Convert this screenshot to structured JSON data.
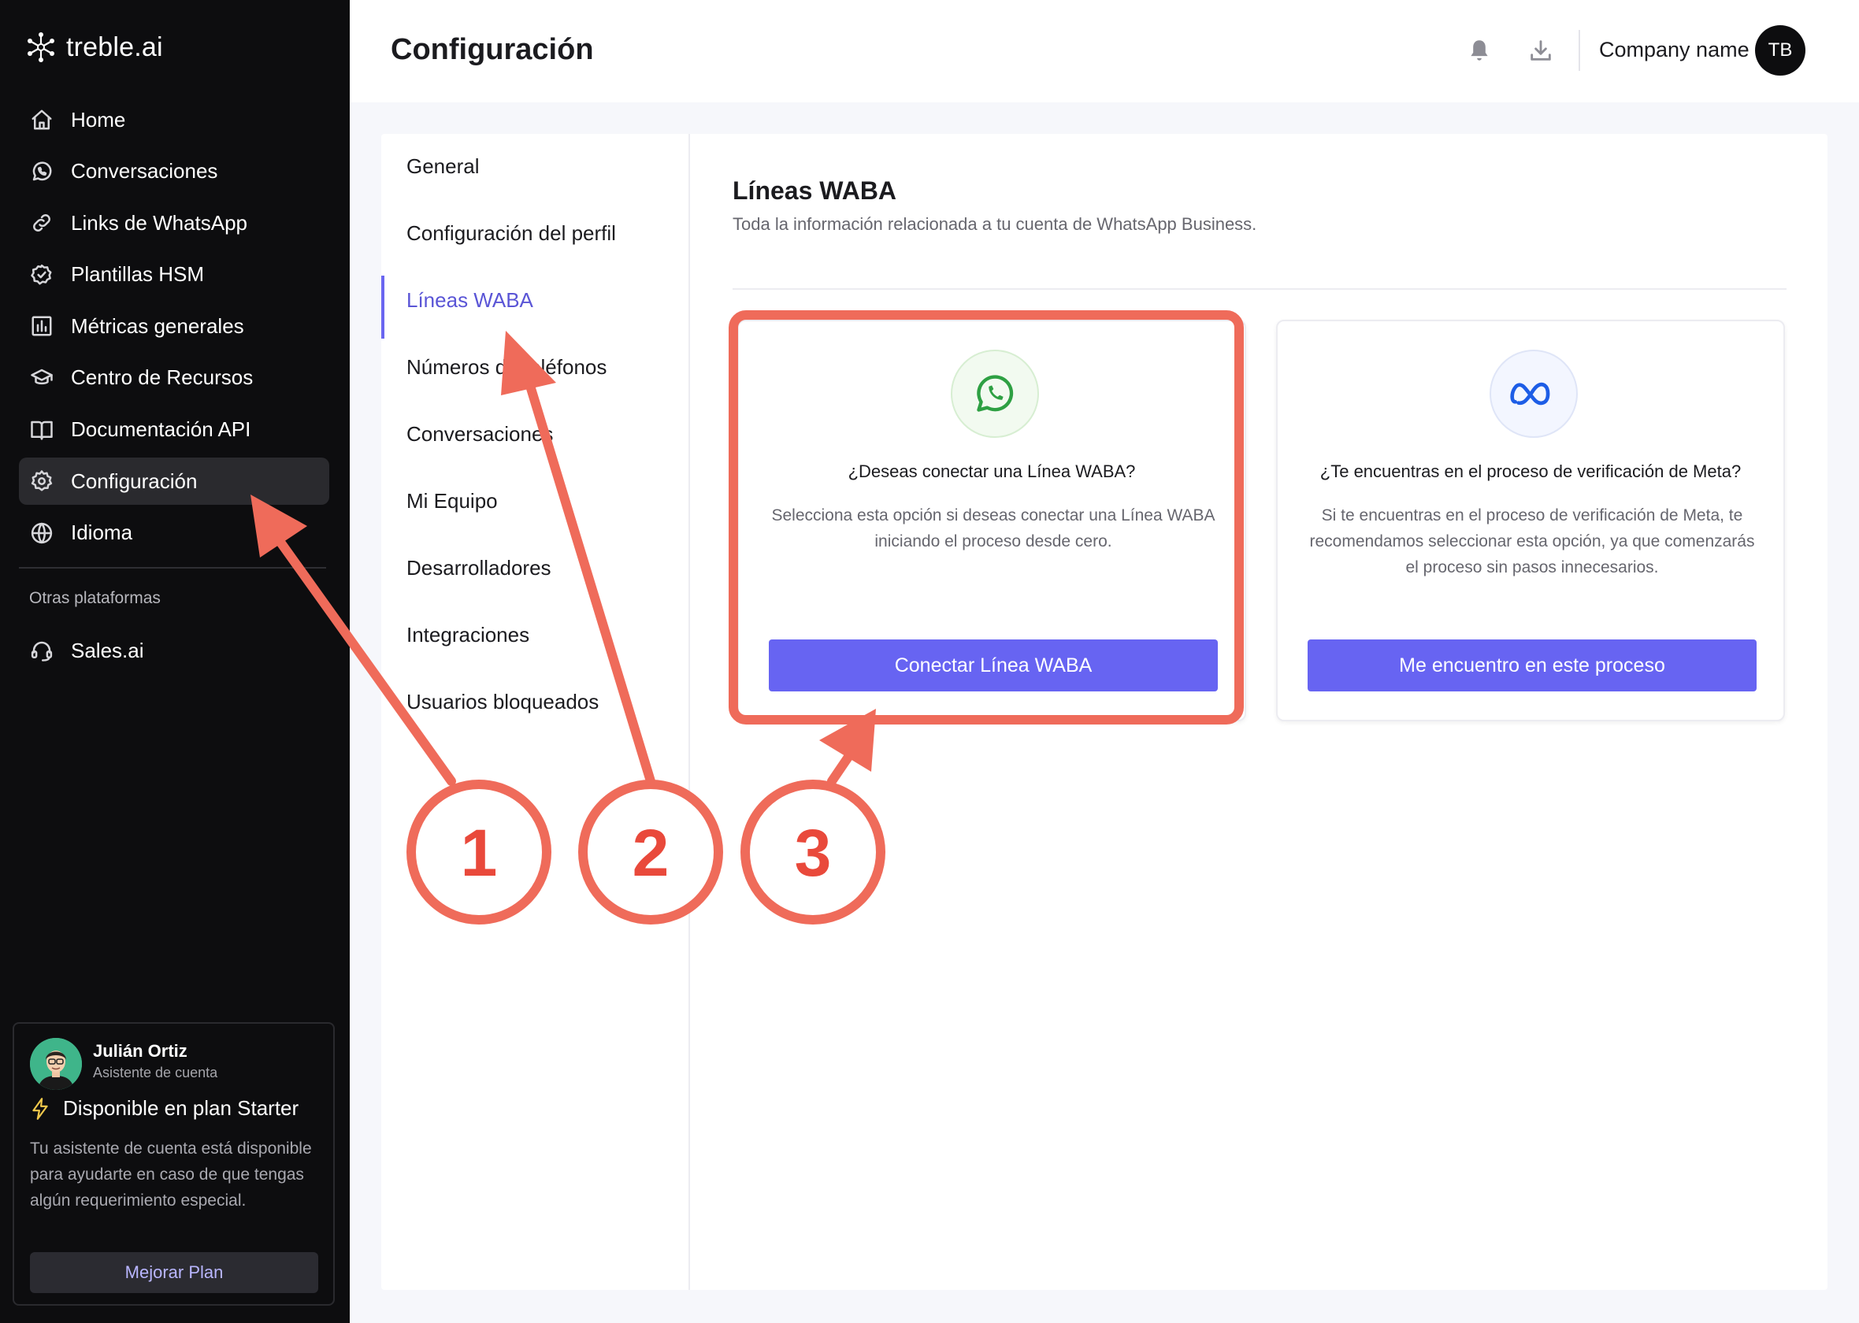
{
  "app": {
    "logo_text": "treble.ai"
  },
  "sidebar": {
    "items": [
      {
        "label": "Home",
        "icon": "home-icon"
      },
      {
        "label": "Conversaciones",
        "icon": "whatsapp-icon"
      },
      {
        "label": "Links de WhatsApp",
        "icon": "link-icon"
      },
      {
        "label": "Plantillas HSM",
        "icon": "badge-check-icon"
      },
      {
        "label": "Métricas generales",
        "icon": "bar-chart-icon"
      },
      {
        "label": "Centro de Recursos",
        "icon": "graduation-cap-icon"
      },
      {
        "label": "Documentación API",
        "icon": "book-icon"
      },
      {
        "label": "Configuración",
        "icon": "gear-icon",
        "active": true
      },
      {
        "label": "Idioma",
        "icon": "globe-icon"
      }
    ],
    "other_section_label": "Otras plataformas",
    "other_items": [
      {
        "label": "Sales.ai",
        "icon": "headset-icon"
      }
    ],
    "assistant": {
      "name": "Julián Ortiz",
      "role": "Asistente de cuenta",
      "plan_text": "Disponible en plan Starter",
      "description": "Tu asistente de cuenta está disponible para ayudarte en caso de que tengas algún requerimiento especial.",
      "upgrade_label": "Mejorar Plan"
    }
  },
  "header": {
    "title": "Configuración",
    "company_name": "Company name",
    "avatar_initials": "TB"
  },
  "settings_nav": {
    "items": [
      "General",
      "Configuración del perfil",
      "Líneas WABA",
      "Números de teléfonos",
      "Conversaciones",
      "Mi Equipo",
      "Desarrolladores",
      "Integraciones",
      "Usuarios bloqueados"
    ],
    "active_index": 2
  },
  "content": {
    "title": "Líneas WABA",
    "subtitle": "Toda la información relacionada a tu cuenta de WhatsApp Business.",
    "cards": [
      {
        "icon": "whatsapp-icon",
        "question": "¿Deseas conectar una Línea WABA?",
        "description": "Selecciona esta opción si deseas conectar una Línea WABA iniciando el proceso desde cero.",
        "button_label": "Conectar Línea WABA"
      },
      {
        "icon": "meta-icon",
        "question": "¿Te encuentras en el proceso de verificación de Meta?",
        "description": "Si te encuentras en el proceso de verificación de Meta, te recomendamos seleccionar esta opción, ya que comenzarás el proceso sin pasos innecesarios.",
        "button_label": "Me encuentro en este proceso"
      }
    ]
  },
  "annotations": {
    "color": "#ef6b5a",
    "steps": [
      "1",
      "2",
      "3"
    ]
  }
}
